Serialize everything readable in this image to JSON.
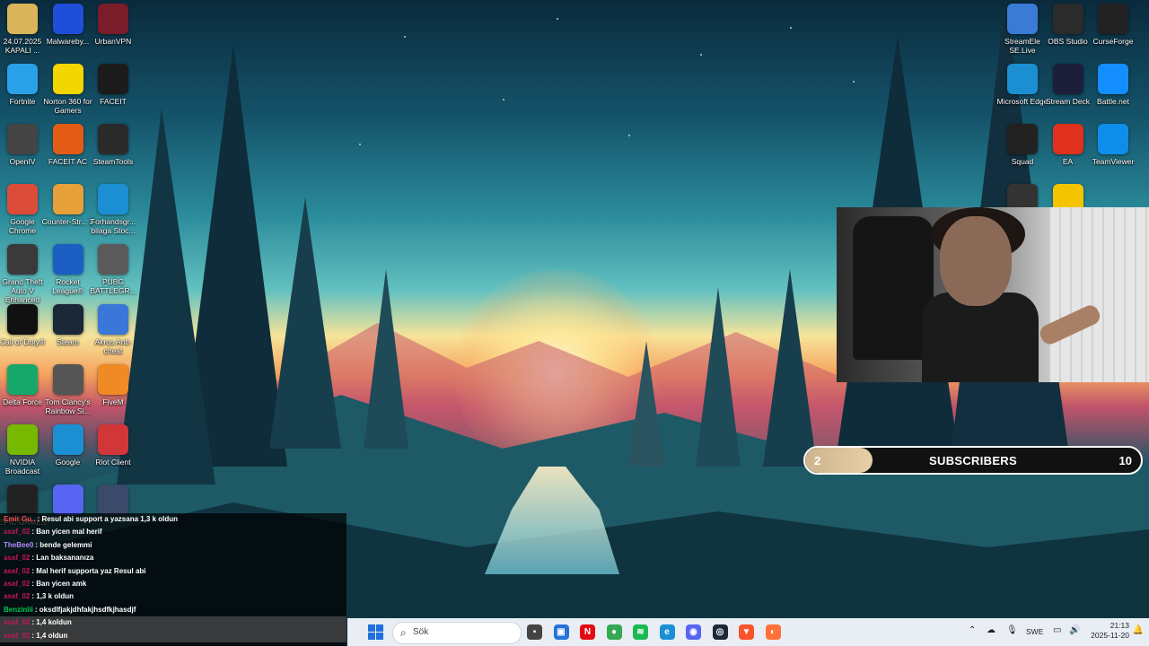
{
  "desktop": {
    "icons_left": [
      {
        "label": "24.07.2025 KAPALI ...",
        "icon": "folder-icon",
        "color": "#d9b45a"
      },
      {
        "label": "Malwareby...",
        "icon": "malwarebytes-icon",
        "color": "#1f4fd8"
      },
      {
        "label": "UrbanVPN",
        "icon": "urbanvpn-icon",
        "color": "#7a1c2a"
      },
      {
        "label": "Fortnite",
        "icon": "fortnite-icon",
        "color": "#2aa0e8"
      },
      {
        "label": "Norton 360 for Gamers",
        "icon": "norton-icon",
        "color": "#f2d600"
      },
      {
        "label": "FACEIT",
        "icon": "faceit-icon",
        "color": "#1b1b1b"
      },
      {
        "label": "OpenIV",
        "icon": "openiv-icon",
        "color": "#444444"
      },
      {
        "label": "FACEIT AC",
        "icon": "faceit-ac-icon",
        "color": "#e25c15"
      },
      {
        "label": "SteamTools",
        "icon": "steamtools-icon",
        "color": "#2a2a2a"
      },
      {
        "label": "Google Chrome",
        "icon": "chrome-icon",
        "color": "#dd4b39"
      },
      {
        "label": "Counter-Str... 2",
        "icon": "cs2-icon",
        "color": "#e8a03a"
      },
      {
        "label": "Forhandsgr... bilaga Stoc...",
        "icon": "edge-icon",
        "color": "#1c8fd3"
      },
      {
        "label": "Grand Theft Auto V Enhanced",
        "icon": "gta-icon",
        "color": "#3a3a3a"
      },
      {
        "label": "Rocket League®",
        "icon": "rocket-league-icon",
        "color": "#1a5ec4"
      },
      {
        "label": "PUBG BATTLEGR...",
        "icon": "pubg-icon",
        "color": "#5a5a5a"
      },
      {
        "label": "Call of Duty®",
        "icon": "cod-icon",
        "color": "#111111"
      },
      {
        "label": "Steam",
        "icon": "steam-icon",
        "color": "#1b2838"
      },
      {
        "label": "Akros Anti-cheat",
        "icon": "shield-icon",
        "color": "#3a77d8"
      },
      {
        "label": "Delta Force",
        "icon": "delta-force-icon",
        "color": "#16a86a"
      },
      {
        "label": "Tom Clancy's Rainbow Si...",
        "icon": "rainbow-six-icon",
        "color": "#555555"
      },
      {
        "label": "FiveM",
        "icon": "fivem-icon",
        "color": "#f08a24"
      },
      {
        "label": "NVIDIA Broadcast",
        "icon": "nvidia-icon",
        "color": "#76b900"
      },
      {
        "label": "Google",
        "icon": "edge-icon",
        "color": "#1c8fd3"
      },
      {
        "label": "Riot Client",
        "icon": "riot-icon",
        "color": "#d13639"
      },
      {
        "label": "EPIC GAMES",
        "icon": "epic-games-icon",
        "color": "#222222"
      },
      {
        "label": "",
        "icon": "discord-icon",
        "color": "#5865f2"
      },
      {
        "label": "",
        "icon": "rocket-icon",
        "color": "#3a4a6a"
      }
    ],
    "icons_right": [
      {
        "label": "StreamEle SE.Live",
        "icon": "streamelements-icon",
        "color": "#3a7bd5"
      },
      {
        "label": "OBS Studio",
        "icon": "obs-icon",
        "color": "#2b2b2b"
      },
      {
        "label": "CurseForge",
        "icon": "curseforge-icon",
        "color": "#222222"
      },
      {
        "label": "Microsoft Edge",
        "icon": "edge-icon",
        "color": "#1c8fd3"
      },
      {
        "label": "Stream Deck",
        "icon": "stream-deck-icon",
        "color": "#1b1f3a"
      },
      {
        "label": "Battle.net",
        "icon": "battlenet-icon",
        "color": "#148eff"
      },
      {
        "label": "Squad",
        "icon": "squad-icon",
        "color": "#222222"
      },
      {
        "label": "EA",
        "icon": "ea-icon",
        "color": "#e0301e"
      },
      {
        "label": "TeamViewer",
        "icon": "teamviewer-icon",
        "color": "#0e8ee9"
      },
      {
        "label": "",
        "icon": "ubisoft-icon",
        "color": "#333333"
      },
      {
        "label": "",
        "icon": "rockstar-icon",
        "color": "#f5c400"
      }
    ]
  },
  "subscribers": {
    "current": "2",
    "title": "SUBSCRIBERS",
    "goal": "10",
    "progress": 0.2
  },
  "chat": [
    {
      "user": "Emir Gu..",
      "user_color": "#ff4a4a",
      "text": ": Resul abi support a yazsana 1,3 k oldun"
    },
    {
      "user": "asaf_02",
      "user_color": "#c2185b",
      "text": ": Ban yicen mal herif"
    },
    {
      "user": "TheBee0",
      "user_color": "#b388ff",
      "text": ": bende gelemmi"
    },
    {
      "user": "asaf_02",
      "user_color": "#c2185b",
      "text": ": Lan baksananıza"
    },
    {
      "user": "asaf_02",
      "user_color": "#c2185b",
      "text": ": Mal herif supporta yaz Resul abi"
    },
    {
      "user": "asaf_02",
      "user_color": "#c2185b",
      "text": ": Ban yicen amk"
    },
    {
      "user": "asaf_02",
      "user_color": "#c2185b",
      "text": ": 1,3 k oldun"
    },
    {
      "user": "Benzinlii",
      "user_color": "#00c853",
      "text": ": oksdlfjakjdhfakjhsdfkjhasdjf"
    },
    {
      "user": "asaf_02",
      "user_color": "#c2185b",
      "text": ": 1,4 koldun"
    },
    {
      "user": "asaf_02",
      "user_color": "#c2185b",
      "text": ": 1,4 oldun"
    }
  ],
  "taskbar": {
    "search_placeholder": "Sök",
    "apps": [
      {
        "icon": "file-explorer-icon",
        "color": "#444444",
        "glyph": "▪"
      },
      {
        "icon": "store-icon",
        "color": "#2673d8",
        "glyph": "▣"
      },
      {
        "icon": "netflix-icon",
        "color": "#e50914",
        "glyph": "N"
      },
      {
        "icon": "chrome-icon",
        "color": "#34a853",
        "glyph": "●"
      },
      {
        "icon": "spotify-icon",
        "color": "#1db954",
        "glyph": "≋"
      },
      {
        "icon": "edge-icon",
        "color": "#1c8fd3",
        "glyph": "e"
      },
      {
        "icon": "discord-icon",
        "color": "#5865f2",
        "glyph": "◉"
      },
      {
        "icon": "steam-icon",
        "color": "#1b2838",
        "glyph": "◎"
      },
      {
        "icon": "brave-icon",
        "color": "#fb542b",
        "glyph": "▼"
      },
      {
        "icon": "firefox-icon",
        "color": "#ff7139",
        "glyph": "◐"
      }
    ],
    "language": "SWE",
    "time": "21:13",
    "date": "2025-11-20"
  }
}
